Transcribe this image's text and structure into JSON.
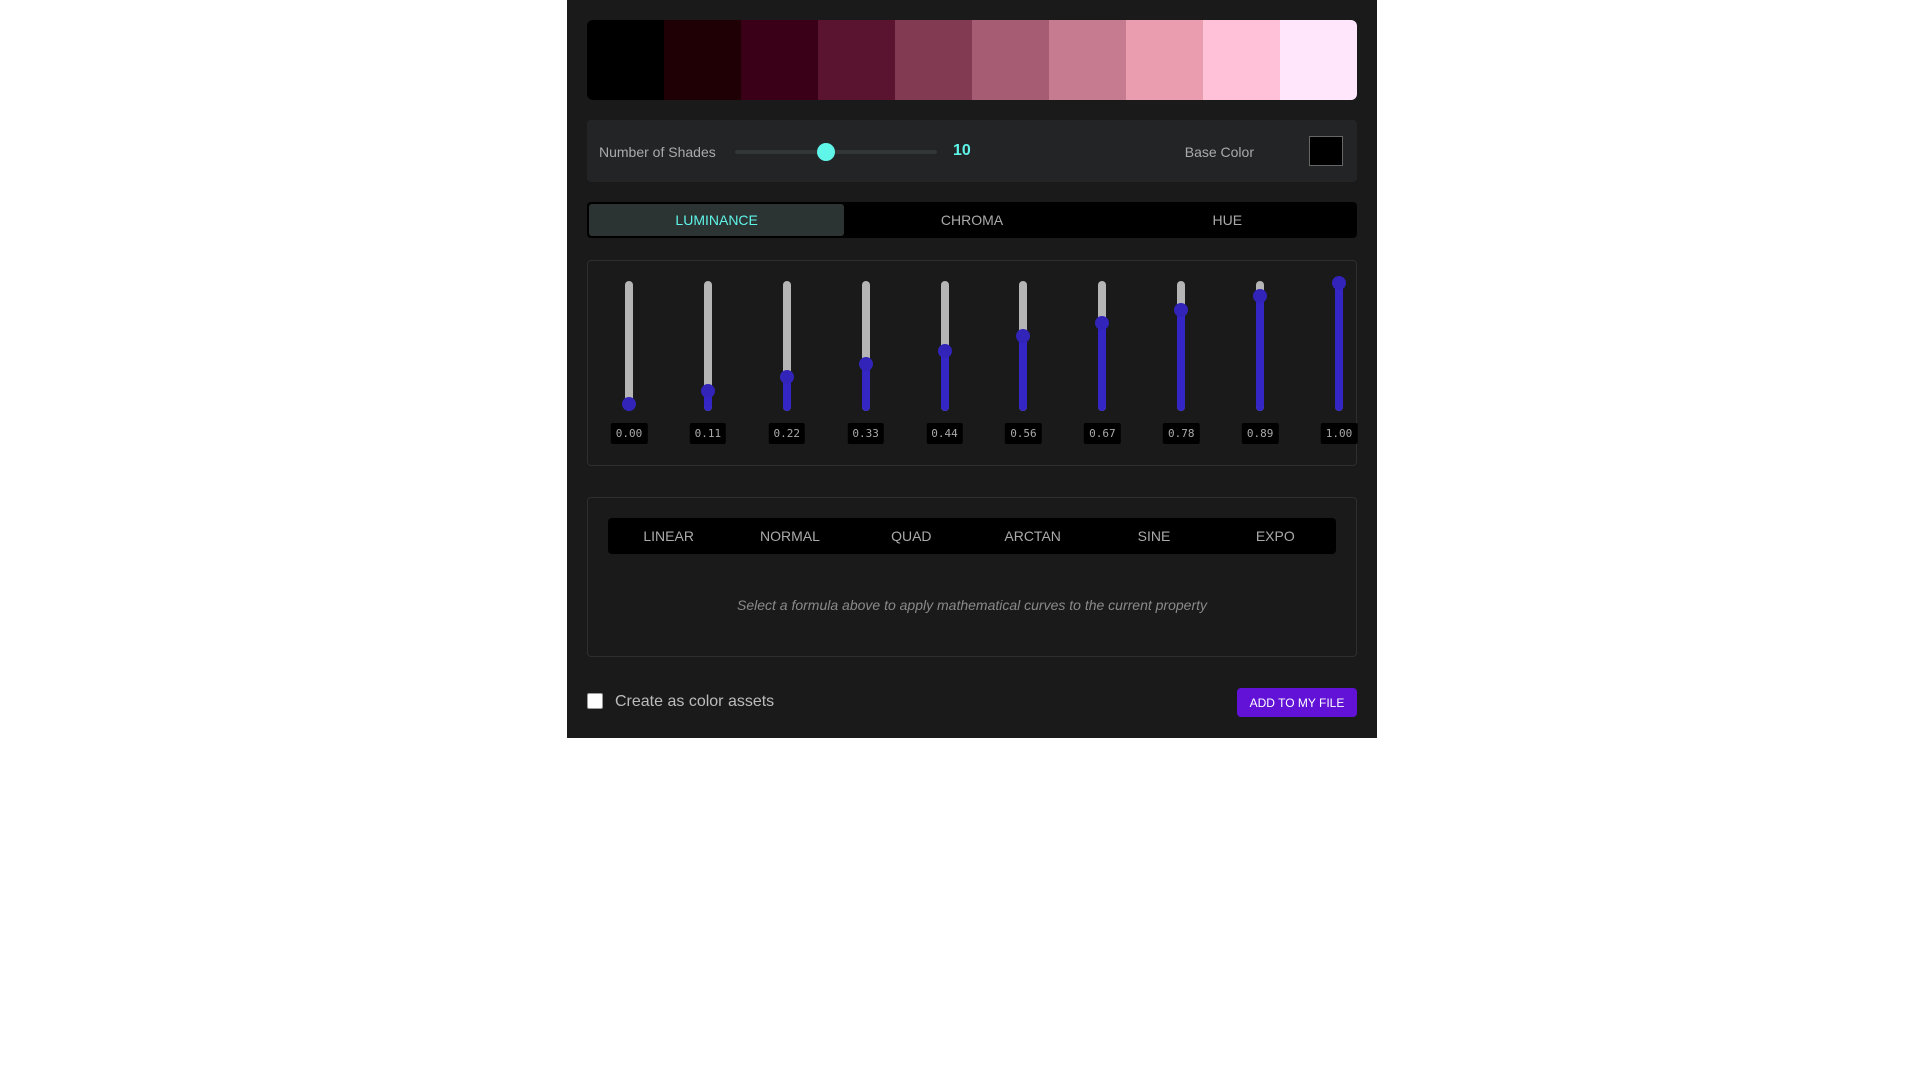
{
  "palette": {
    "swatches": [
      "#000000",
      "#1f0005",
      "#3a0018",
      "#5b1430",
      "#813a52",
      "#a65c73",
      "#c77b90",
      "#eb9db0",
      "#ffc1d8",
      "#ffe6fb"
    ]
  },
  "controls": {
    "shades_label": "Number of Shades",
    "shades_value": "10",
    "shades_fraction": 0.45,
    "base_color_label": "Base Color",
    "base_color": "#000000",
    "accent_color": "#5ff5e8"
  },
  "tabs": [
    {
      "label": "LUMINANCE",
      "active": true
    },
    {
      "label": "CHROMA",
      "active": false
    },
    {
      "label": "HUE",
      "active": false
    }
  ],
  "sliders": [
    {
      "value": 0.0,
      "label": "0.00"
    },
    {
      "value": 0.11,
      "label": "0.11"
    },
    {
      "value": 0.22,
      "label": "0.22"
    },
    {
      "value": 0.33,
      "label": "0.33"
    },
    {
      "value": 0.44,
      "label": "0.44"
    },
    {
      "value": 0.56,
      "label": "0.56"
    },
    {
      "value": 0.67,
      "label": "0.67"
    },
    {
      "value": 0.78,
      "label": "0.78"
    },
    {
      "value": 0.89,
      "label": "0.89"
    },
    {
      "value": 1.0,
      "label": "1.00"
    }
  ],
  "formulas": [
    "LINEAR",
    "NORMAL",
    "QUAD",
    "ARCTAN",
    "SINE",
    "EXPO"
  ],
  "formula_hint": "Select a formula above to apply mathematical curves to the current property",
  "footer": {
    "assets_label": "Create as color assets",
    "assets_checked": false,
    "add_button_label": "ADD TO MY FILE",
    "add_button_color": "#6112d6"
  }
}
